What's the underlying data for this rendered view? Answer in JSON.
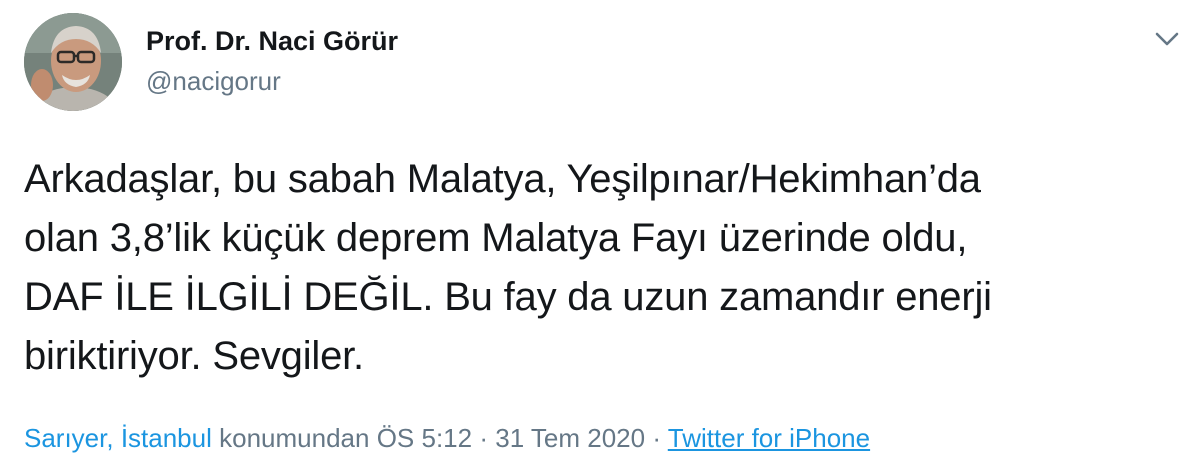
{
  "author": {
    "display_name": "Prof. Dr. Naci Görür",
    "handle": "@nacigorur"
  },
  "icons": {
    "avatar": "profile-photo",
    "menu": "chevron-down-icon"
  },
  "tweet": {
    "lines": [
      "Arkadaşlar, bu sabah Malatya, Yeşilpınar/Hekimhan’da",
      "olan 3,8’lik küçük deprem Malatya Fayı üzerinde oldu,",
      "DAF İLE İLGİLİ DEĞİL. Bu fay da uzun zamandır enerji",
      "biriktiriyor. Sevgiler."
    ]
  },
  "meta": {
    "location": "Sarıyer, İstanbul",
    "location_suffix": "konumundan",
    "time": "ÖS 5:12",
    "separator": "·",
    "date": "31 Tem 2020",
    "source": "Twitter for iPhone"
  },
  "colors": {
    "text": "#14171a",
    "secondary": "#657786",
    "link": "#1b95e0"
  }
}
